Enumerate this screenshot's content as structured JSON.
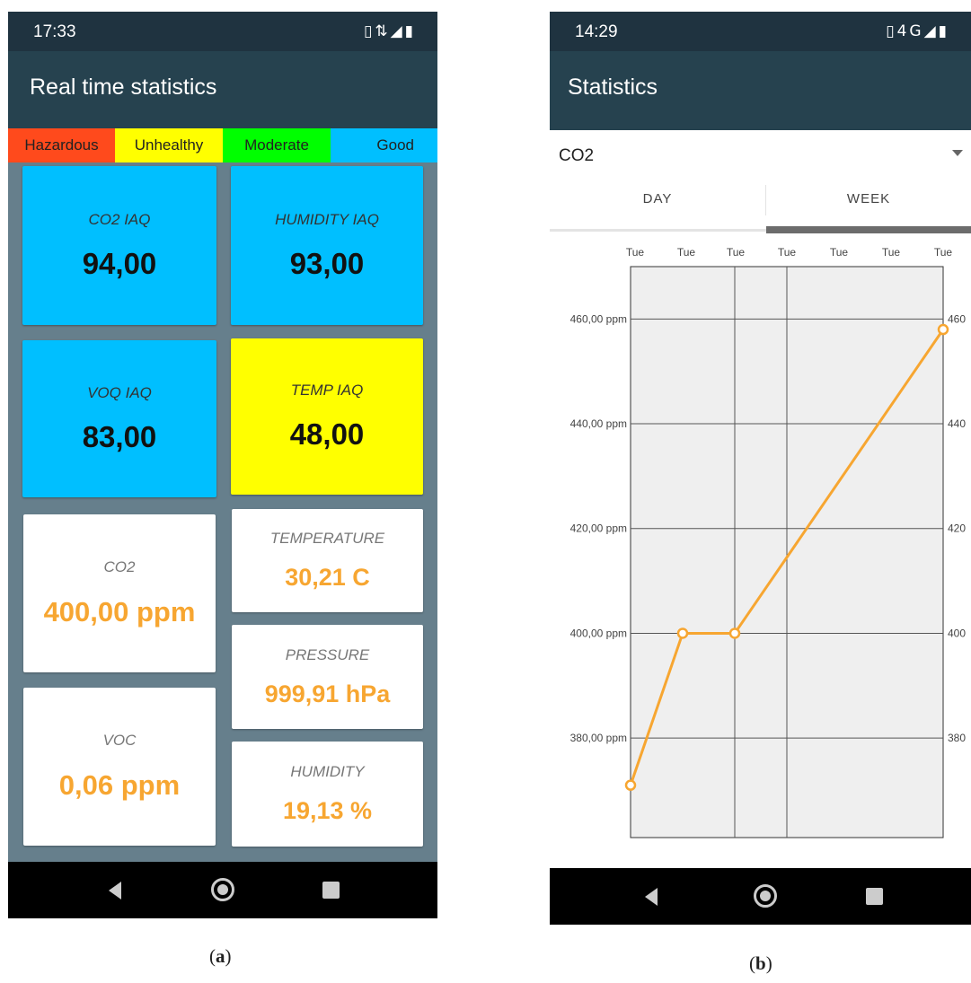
{
  "screen_a": {
    "status_time": "17:33",
    "status_icons": "vibrate-icon wifi-icon signal-icon battery-icon",
    "title": "Real time statistics",
    "legend": [
      {
        "label": "Hazardous",
        "color": "#ff4a1c"
      },
      {
        "label": "Unhealthy",
        "color": "#ffff00"
      },
      {
        "label": "Moderate",
        "color": "#00ff00"
      },
      {
        "label": "Good",
        "color": "#00bfff"
      }
    ],
    "iaq": [
      {
        "label": "CO2 IAQ",
        "value": "94,00",
        "color": "#00bfff"
      },
      {
        "label": "HUMIDITY IAQ",
        "value": "93,00",
        "color": "#00bfff"
      },
      {
        "label": "VOQ IAQ",
        "value": "83,00",
        "color": "#00bfff"
      },
      {
        "label": "TEMP IAQ",
        "value": "48,00",
        "color": "#ffff00"
      }
    ],
    "sensors": {
      "co2": {
        "label": "CO2",
        "value": "400,00 ppm"
      },
      "voc": {
        "label": "VOC",
        "value": "0,06 ppm"
      },
      "temperature": {
        "label": "TEMPERATURE",
        "value": "30,21 C"
      },
      "pressure": {
        "label": "PRESSURE",
        "value": "999,91 hPa"
      },
      "humidity": {
        "label": "HUMIDITY",
        "value": "19,13 %"
      }
    },
    "value_color": "#f7a631",
    "caption_letter": "a"
  },
  "screen_b": {
    "status_time": "14:29",
    "status_network": "4G",
    "title": "Statistics",
    "spinner_value": "CO2",
    "tabs": [
      {
        "label": "DAY",
        "selected": false
      },
      {
        "label": "WEEK",
        "selected": true
      }
    ],
    "caption_letter": "b"
  },
  "chart_data": {
    "type": "line",
    "x_tick_labels": [
      "Tue",
      "Tue",
      "Tue",
      "Tue",
      "Tue",
      "Tue",
      "Tue"
    ],
    "y_left_ticks": [
      "460,00 ppm",
      "440,00 ppm",
      "420,00 ppm",
      "400,00 ppm",
      "380,00 ppm"
    ],
    "y_right_ticks": [
      "460",
      "440",
      "420",
      "400",
      "380"
    ],
    "y_tick_values": [
      460,
      440,
      420,
      400,
      380
    ],
    "ylim": [
      361,
      470
    ],
    "series": [
      {
        "color": "#f7a631",
        "x": [
          0,
          1,
          2,
          6
        ],
        "y": [
          371,
          400,
          400,
          458
        ]
      }
    ],
    "grid": true,
    "xlim": [
      0,
      6
    ]
  }
}
